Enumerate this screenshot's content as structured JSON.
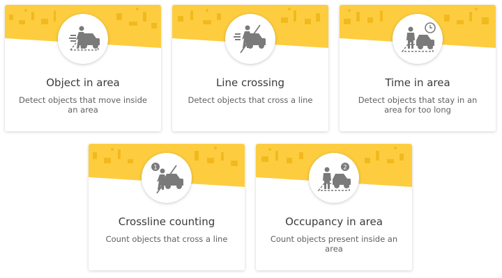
{
  "theme": {
    "accent": "#fdcd3f",
    "accent_dark": "#f2b91e",
    "icon": "#7a7a7a"
  },
  "cards": [
    {
      "title": "Object in area",
      "description": "Detect objects that move inside an area",
      "icon": "person-car-area-icon"
    },
    {
      "title": "Line crossing",
      "description": "Detect objects that cross a line",
      "icon": "person-car-line-icon"
    },
    {
      "title": "Time in area",
      "description": "Detect objects that stay in an area for too long",
      "icon": "person-car-clock-icon"
    },
    {
      "title": "Crossline counting",
      "description": "Count objects that cross a line",
      "icon": "person-car-line-count-icon",
      "badge": "1"
    },
    {
      "title": "Occupancy in area",
      "description": "Count objects present inside an area",
      "icon": "person-car-area-count-icon",
      "badge": "2"
    }
  ]
}
